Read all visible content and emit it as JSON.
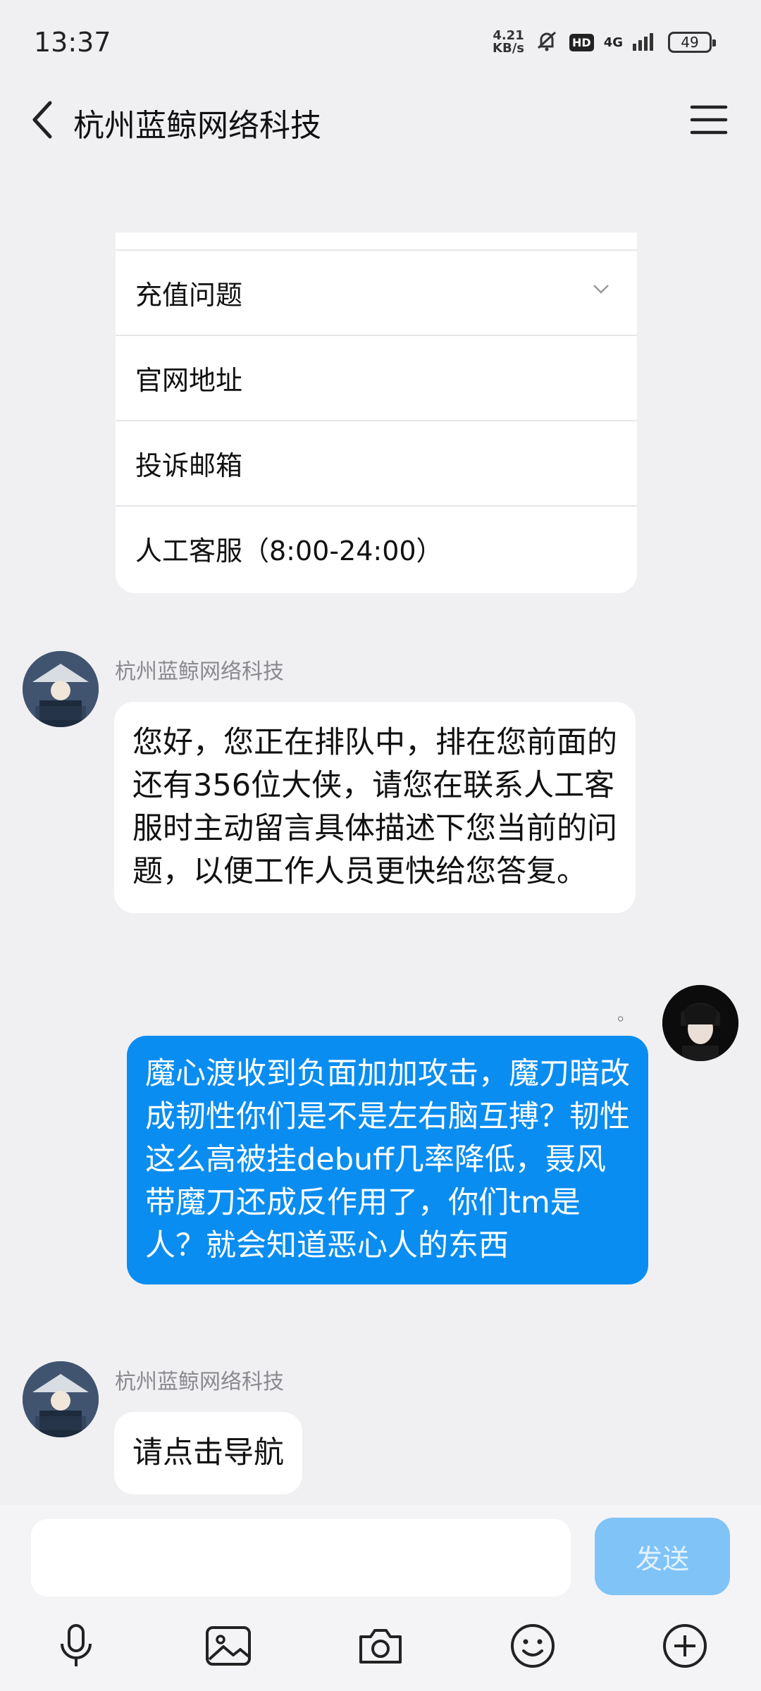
{
  "status": {
    "time": "13:37",
    "net_speed_value": "4.21",
    "net_speed_unit": "KB/s",
    "hd": "HD",
    "network": "4G",
    "battery": "49"
  },
  "header": {
    "title": "杭州蓝鲸网络科技"
  },
  "menu": {
    "items": [
      {
        "label": "充值问题"
      },
      {
        "label": "官网地址"
      },
      {
        "label": "投诉邮箱"
      },
      {
        "label": "人工客服（8:00-24:00）"
      }
    ]
  },
  "messages": [
    {
      "sender": "杭州蓝鲸网络科技",
      "text": "您好，您正在排队中，排在您前面的还有356位大侠，请您在联系人工客服时主动留言具体描述下您当前的问题，以便工作人员更快给您答复。"
    },
    {
      "sender": "",
      "read_mark": "。",
      "text": "魔心渡收到负面加加攻击，魔刀暗改成韧性你们是不是左右脑互搏？韧性这么高被挂debuff几率降低，聂风带魔刀还成反作用了，你们tm是人？就会知道恶心人的东西"
    },
    {
      "sender": "杭州蓝鲸网络科技",
      "text": "请点击导航"
    }
  ],
  "input": {
    "send_label": "发送"
  },
  "colors": {
    "accent": "#0a8df0",
    "send_disabled": "#7fc3f7",
    "background": "#f0f0f3"
  }
}
